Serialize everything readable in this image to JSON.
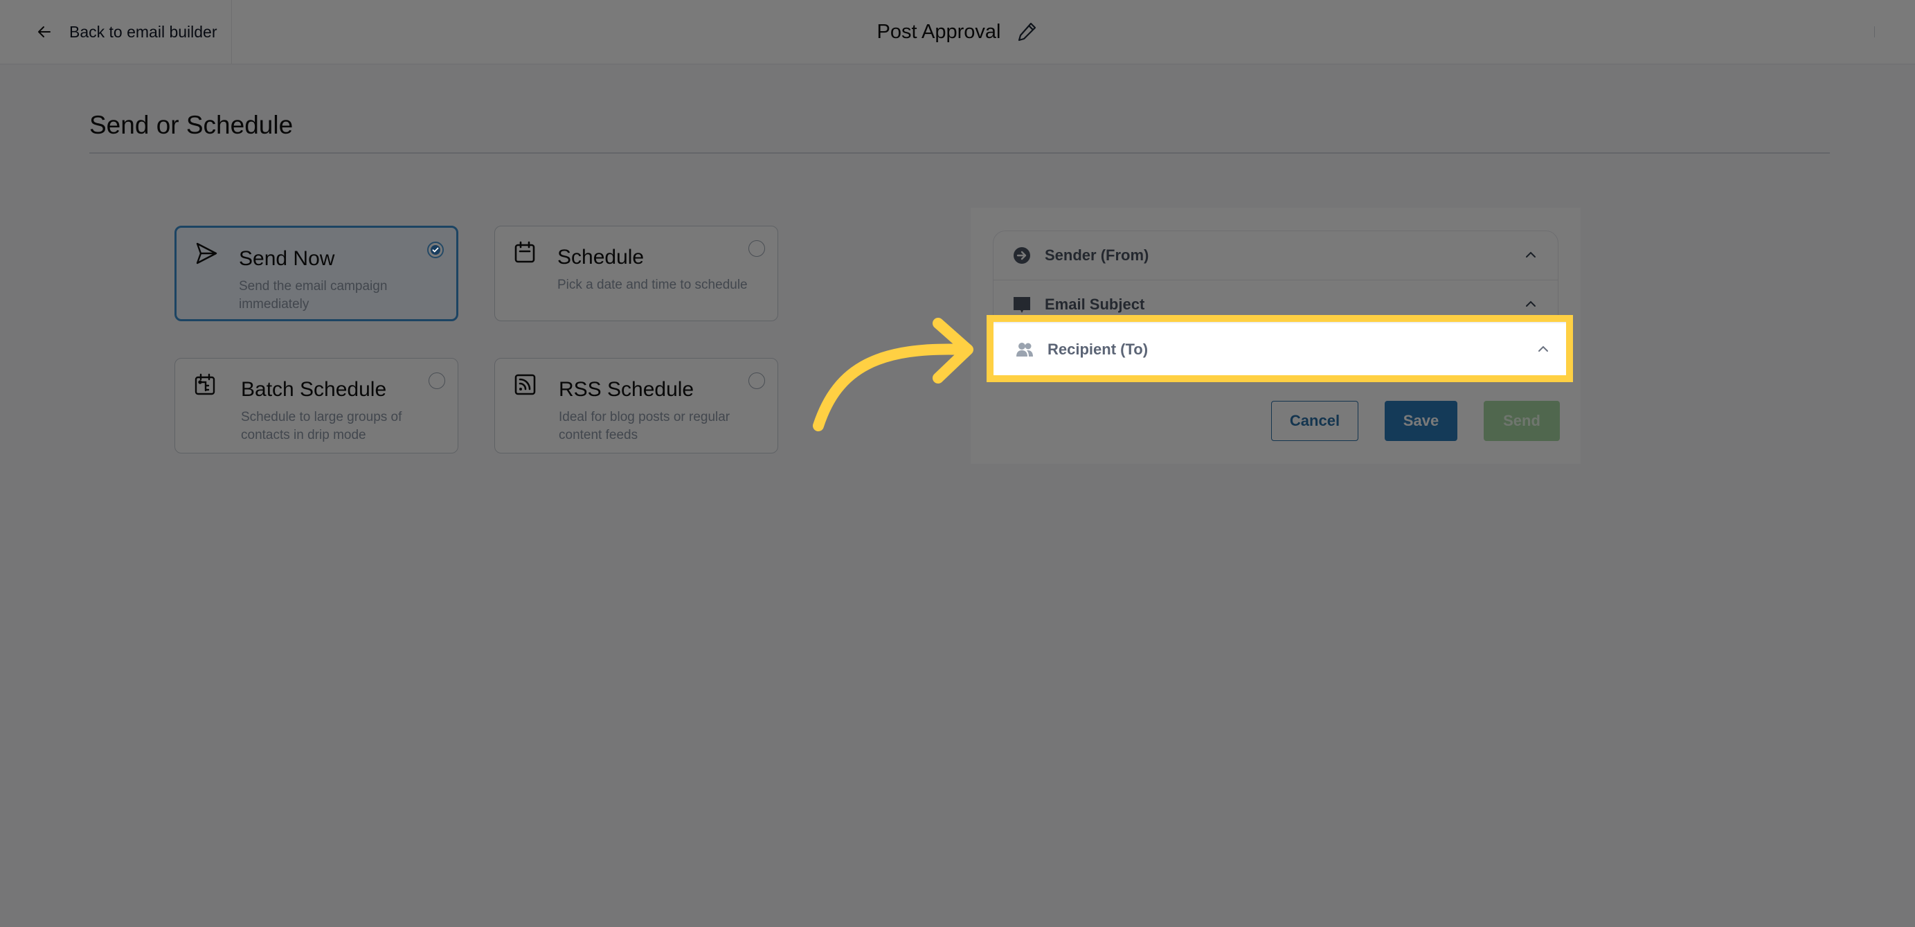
{
  "header": {
    "back_label": "Back to email builder",
    "title": "Post Approval",
    "back_icon": "arrow-left-icon",
    "edit_icon": "pencil-icon"
  },
  "section": {
    "title": "Send or Schedule"
  },
  "options": [
    {
      "title": "Send Now",
      "description": "Send the email campaign immediately",
      "icon": "paper-plane-icon",
      "selected": true
    },
    {
      "title": "Schedule",
      "description": "Pick a date and time to schedule",
      "icon": "calendar-icon",
      "selected": false
    },
    {
      "title": "Batch Schedule",
      "description": "Schedule to large groups of contacts in drip mode",
      "icon": "calendar-batch-icon",
      "selected": false
    },
    {
      "title": "RSS Schedule",
      "description": "Ideal for blog posts or regular content feeds",
      "icon": "rss-icon",
      "selected": false
    }
  ],
  "panel": {
    "sections": [
      {
        "label": "Sender (From)",
        "icon": "arrow-circle-right-icon",
        "expanded": true
      },
      {
        "label": "Email Subject",
        "icon": "speech-bubble-icon",
        "expanded": true
      },
      {
        "label": "Recipient (To)",
        "icon": "users-icon",
        "expanded": true
      }
    ],
    "buttons": {
      "cancel": "Cancel",
      "save": "Save",
      "send": "Send"
    }
  },
  "annotation": {
    "highlight_color": "#ffd043",
    "highlighted_target": "Recipient (To)"
  },
  "colors": {
    "primary": "#2a7ab8",
    "send_disabled": "#a8d8a4",
    "selected_border": "#3b8ed0"
  }
}
